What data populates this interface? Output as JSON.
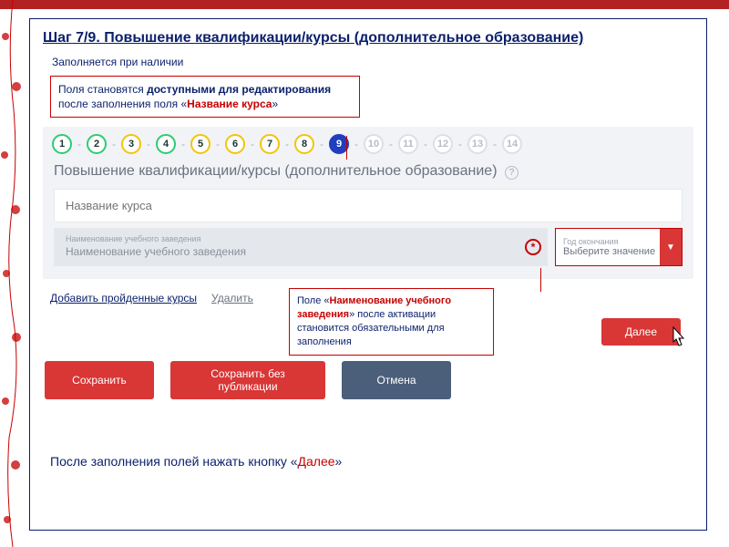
{
  "heading": "Шаг 7/9. Повышение квалификации/курсы (дополнительное образование)",
  "subnote": "Заполняется при наличии",
  "callout1": {
    "prefix": "Поля становятся ",
    "bold1": "доступными для редактирования",
    "mid": " после заполнения поля «",
    "bold2": "Название курса",
    "suffix": "»"
  },
  "steps": [
    {
      "n": "1",
      "state": "done"
    },
    {
      "n": "2",
      "state": "done"
    },
    {
      "n": "3",
      "state": "pending"
    },
    {
      "n": "4",
      "state": "done"
    },
    {
      "n": "5",
      "state": "pending"
    },
    {
      "n": "6",
      "state": "pending"
    },
    {
      "n": "7",
      "state": "pending"
    },
    {
      "n": "8",
      "state": "pending"
    },
    {
      "n": "9",
      "state": "current"
    },
    {
      "n": "10",
      "state": "inactive"
    },
    {
      "n": "11",
      "state": "inactive"
    },
    {
      "n": "12",
      "state": "inactive"
    },
    {
      "n": "13",
      "state": "inactive"
    },
    {
      "n": "14",
      "state": "inactive"
    }
  ],
  "section_title": "Повышение квалификации/курсы (дополнительное образование)",
  "course_placeholder": "Название курса",
  "inst_label": "Наименование учебного заведения",
  "inst_value": "Наименование учебного заведения",
  "asterisk": "*",
  "year_label": "Год окончания",
  "year_value": "Выберите значение",
  "link_add": "Добавить пройденные курсы",
  "link_del": "Удалить",
  "callout2": {
    "prefix": "Поле «",
    "bold": "Наименование учебного заведения",
    "suffix": "» после активации становится обязательными для заполнения"
  },
  "btn_next": "Далее",
  "btn_save": "Сохранить",
  "btn_save_draft": "Сохранить без публикации",
  "btn_cancel": "Отмена",
  "bottom": {
    "prefix": "После заполнения полей нажать кнопку «",
    "bold": "Далее",
    "suffix": "»"
  }
}
